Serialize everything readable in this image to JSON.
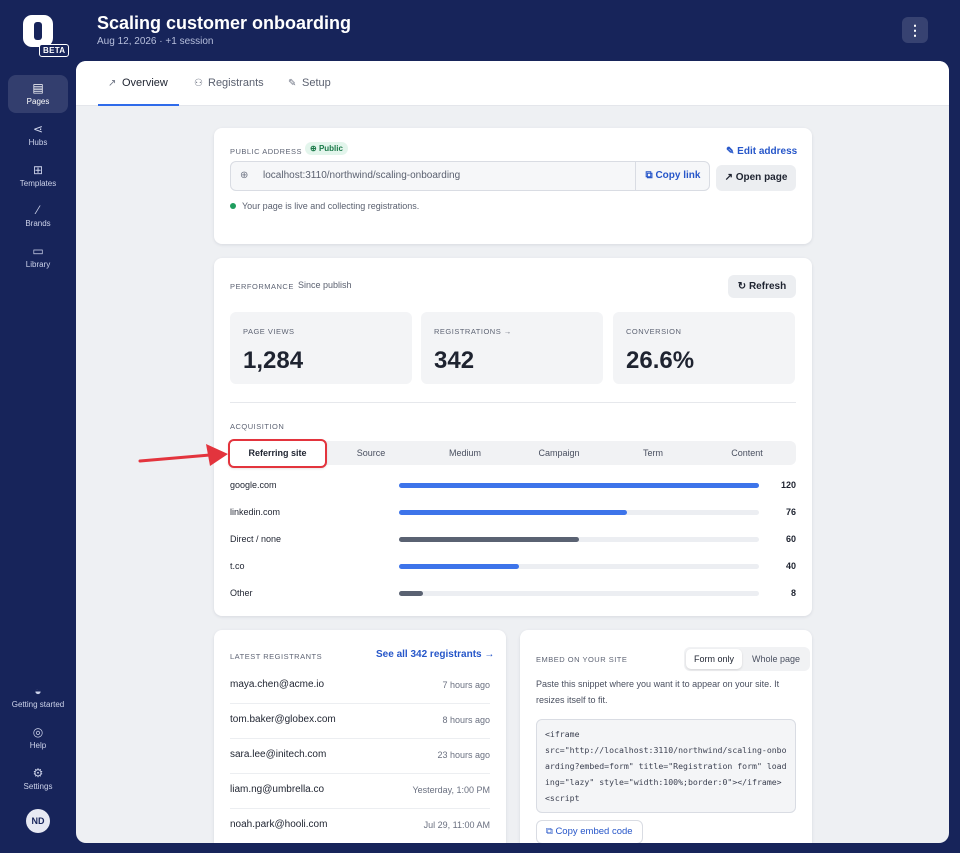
{
  "sidebar": {
    "beta": "BETA",
    "items": [
      {
        "label": "Pages",
        "icon": "pages-icon"
      },
      {
        "label": "Hubs",
        "icon": "share-icon"
      },
      {
        "label": "Templates",
        "icon": "grid-icon"
      },
      {
        "label": "Brands",
        "icon": "brush-icon"
      },
      {
        "label": "Library",
        "icon": "tv-icon"
      }
    ],
    "bottom_items": [
      {
        "label": "Getting started",
        "icon": "rocket-icon"
      },
      {
        "label": "Help",
        "icon": "lifebuoy-icon"
      },
      {
        "label": "Settings",
        "icon": "gear-icon"
      }
    ],
    "avatar": "ND"
  },
  "header": {
    "title": "Scaling customer onboarding",
    "subtitle": "Aug 12, 2026 · +1 session"
  },
  "tabs": [
    "Overview",
    "Registrants",
    "Setup"
  ],
  "address": {
    "label": "PUBLIC ADDRESS",
    "badge": "Public",
    "edit": "Edit address",
    "url": "localhost:3110/northwind/scaling-onboarding",
    "copy": "Copy link",
    "open": "Open page",
    "status": "Your page is live and collecting registrations."
  },
  "performance": {
    "label": "PERFORMANCE",
    "since": "Since publish",
    "refresh": "Refresh",
    "stats": [
      {
        "label": "PAGE VIEWS",
        "value": "1,284"
      },
      {
        "label": "REGISTRATIONS →",
        "value": "342"
      },
      {
        "label": "CONVERSION",
        "value": "26.6%"
      }
    ]
  },
  "acquisition": {
    "label": "ACQUISITION",
    "tabs": [
      "Referring site",
      "Source",
      "Medium",
      "Campaign",
      "Term",
      "Content"
    ],
    "max": 120,
    "rows": [
      {
        "name": "google.com",
        "count": 120,
        "color": "#3d74ea"
      },
      {
        "name": "linkedin.com",
        "count": 76,
        "color": "#3d74ea"
      },
      {
        "name": "Direct / none",
        "count": 60,
        "color": "#5a6272"
      },
      {
        "name": "t.co",
        "count": 40,
        "color": "#3d74ea"
      },
      {
        "name": "Other",
        "count": 8,
        "color": "#5a6272"
      }
    ]
  },
  "registrants": {
    "label": "LATEST REGISTRANTS",
    "see_all": "See all 342 registrants →",
    "rows": [
      {
        "email": "maya.chen@acme.io",
        "time": "7 hours ago"
      },
      {
        "email": "tom.baker@globex.com",
        "time": "8 hours ago"
      },
      {
        "email": "sara.lee@initech.com",
        "time": "23 hours ago"
      },
      {
        "email": "liam.ng@umbrella.co",
        "time": "Yesterday, 1:00 PM"
      },
      {
        "email": "noah.park@hooli.com",
        "time": "Jul 29, 11:00 AM"
      }
    ]
  },
  "embed": {
    "label": "EMBED ON YOUR SITE",
    "options": [
      "Form only",
      "Whole page"
    ],
    "desc": "Paste this snippet where you want it to appear on your site. It resizes itself to fit.",
    "code": "<iframe\nsrc=\"http://localhost:3110/northwind/scaling-onboarding?embed=form\" title=\"Registration form\" loading=\"lazy\" style=\"width:100%;border:0\"></iframe>\n<script",
    "copy": "Copy embed code"
  },
  "colors": {
    "sidebar": "#17245a",
    "accent": "#2f6bea",
    "highlight": "#e3343d"
  }
}
